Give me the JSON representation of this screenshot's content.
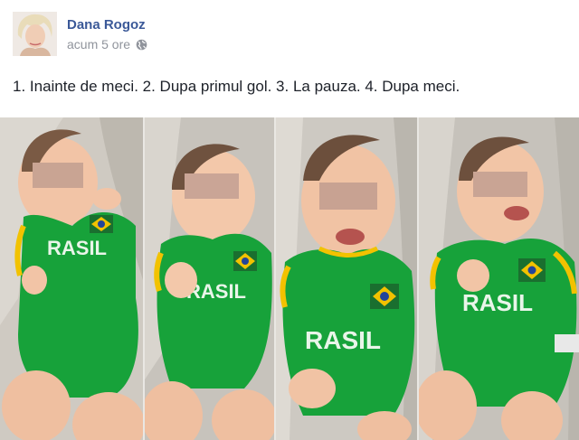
{
  "post": {
    "author": "Dana Rogoz",
    "timestamp": "acum 5 ore",
    "privacy_icon": "globe-icon",
    "text": "1. Inainte de meci. 2. Dupa primul gol. 3. La pauza. 4. Dupa meci.",
    "photo": {
      "panels": [
        {
          "shirt_text": "RASIL"
        },
        {
          "shirt_text": "RASIL"
        },
        {
          "shirt_text": "RASIL"
        },
        {
          "shirt_text": "RASIL"
        }
      ]
    }
  },
  "colors": {
    "link": "#3b5998",
    "meta": "#90949c",
    "text": "#1d2129",
    "shirt": "#17a23a",
    "shirt_trim": "#f2c200"
  }
}
